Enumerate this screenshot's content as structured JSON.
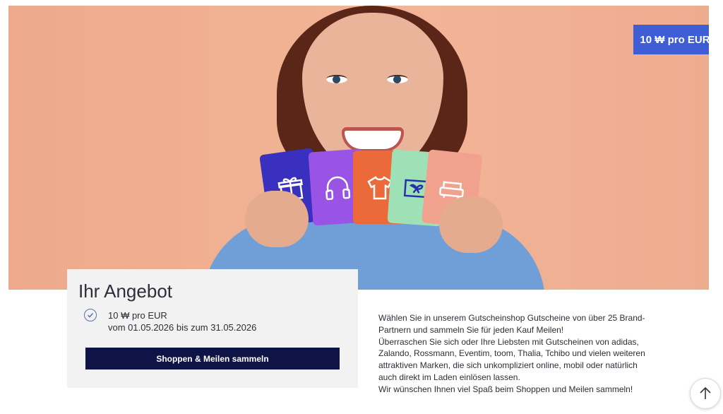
{
  "hero": {
    "badge": "10 ₩ pro EUR",
    "card_icons": [
      "gift-icon",
      "headphones-icon",
      "tshirt-icon",
      "ticket-icon",
      "sofa-icon"
    ]
  },
  "offer": {
    "title": "Ihr Angebot",
    "rate": "10 ₩ pro EUR",
    "period": "vom 01.05.2026 bis zum 31.05.2026",
    "cta_label": "Shoppen & Meilen sammeln"
  },
  "description": {
    "para1": "Wählen Sie in unserem Gutscheinshop Gutscheine von über 25 Brand-Partnern und sammeln Sie für jeden Kauf Meilen!",
    "para2": "Überraschen Sie sich oder Ihre Liebsten mit Gutscheinen von adidas, Zalando, Rossmann, Eventim, toom, Thalia, Tchibo und vielen weiteren attraktiven Marken, die sich unkompliziert online, mobil oder natürlich auch direkt im Laden einlösen lassen.",
    "para3": "Wir wünschen Ihnen viel Spaß beim Shoppen und Meilen sammeln!"
  },
  "colors": {
    "accent": "#3f5ed6",
    "cta_bg": "#0e1446",
    "hero_bg": "#f1b294"
  },
  "scroll_top_icon": "arrow-up-icon"
}
